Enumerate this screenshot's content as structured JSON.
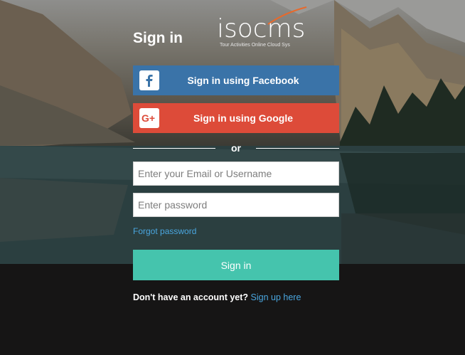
{
  "header": {
    "title": "Sign in",
    "logo_text": "isocms",
    "logo_tagline": "Tour Activities Online Cloud Sys"
  },
  "social": {
    "facebook_label": "Sign in using Facebook",
    "google_label": "Sign in using Google",
    "facebook_color": "#3a73a8",
    "google_color": "#dd4b39"
  },
  "divider": {
    "label": "or"
  },
  "form": {
    "username_placeholder": "Enter your Email or Username",
    "username_value": "",
    "password_placeholder": "Enter password",
    "password_value": "",
    "forgot_label": "Forgot password",
    "submit_label": "Sign in",
    "submit_color": "#45c4ad"
  },
  "signup": {
    "question": "Don't have an account yet?",
    "link_label": "Sign up here"
  }
}
